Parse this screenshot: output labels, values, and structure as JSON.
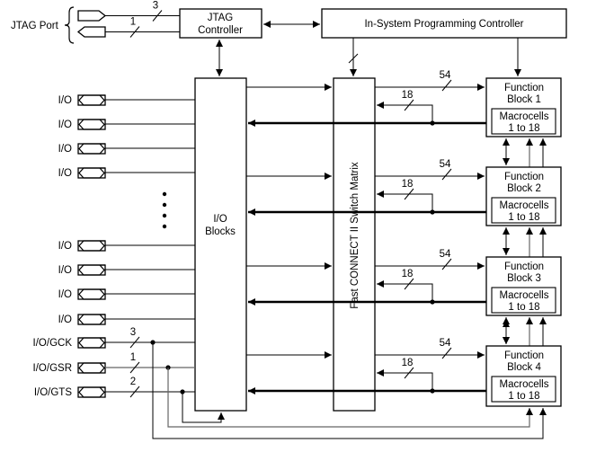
{
  "jtag_port_label": "JTAG Port",
  "jtag_controller": [
    "JTAG",
    "Controller"
  ],
  "isp_controller": "In-System Programming Controller",
  "io_blocks": [
    "I/O",
    "Blocks"
  ],
  "switch_matrix": "Fast CONNECT II Switch Matrix",
  "jtag_bus_widths": [
    "3",
    "1"
  ],
  "io_pins_top": [
    "I/O",
    "I/O",
    "I/O",
    "I/O"
  ],
  "io_pins_bottom": [
    "I/O",
    "I/O",
    "I/O",
    "I/O"
  ],
  "global_pins": [
    {
      "label": "I/O/GCK",
      "width": "3"
    },
    {
      "label": "I/O/GSR",
      "width": "1"
    },
    {
      "label": "I/O/GTS",
      "width": "2"
    }
  ],
  "function_blocks": [
    {
      "title": [
        "Function",
        "Block 1"
      ],
      "macro": [
        "Macrocells",
        "1 to 18"
      ],
      "in_width": "54",
      "fb_width": "18"
    },
    {
      "title": [
        "Function",
        "Block 2"
      ],
      "macro": [
        "Macrocells",
        "1 to 18"
      ],
      "in_width": "54",
      "fb_width": "18"
    },
    {
      "title": [
        "Function",
        "Block 3"
      ],
      "macro": [
        "Macrocells",
        "1 to 18"
      ],
      "in_width": "54",
      "fb_width": "18"
    },
    {
      "title": [
        "Function",
        "Block 4"
      ],
      "macro": [
        "Macrocells",
        "1 to 18"
      ],
      "in_width": "54",
      "fb_width": "18"
    }
  ]
}
